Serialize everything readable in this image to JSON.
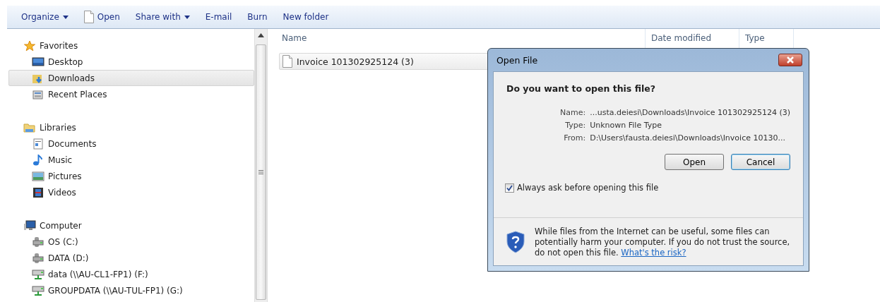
{
  "toolbar": [
    {
      "label": "Organize",
      "kind": "menu"
    },
    {
      "label": "Open",
      "kind": "file"
    },
    {
      "label": "Share with",
      "kind": "menu"
    },
    {
      "label": "E-mail",
      "kind": "plain"
    },
    {
      "label": "Burn",
      "kind": "plain"
    },
    {
      "label": "New folder",
      "kind": "plain"
    }
  ],
  "sidebar": {
    "groups": [
      {
        "label": "Favorites",
        "kind": "favorites",
        "selected": false,
        "children": [
          {
            "label": "Desktop",
            "kind": "desktop",
            "selected": false
          },
          {
            "label": "Downloads",
            "kind": "downloads",
            "selected": true
          },
          {
            "label": "Recent Places",
            "kind": "recent",
            "selected": false
          }
        ]
      },
      {
        "label": "Libraries",
        "kind": "libraries",
        "selected": false,
        "children": [
          {
            "label": "Documents",
            "kind": "documents",
            "selected": false
          },
          {
            "label": "Music",
            "kind": "music",
            "selected": false
          },
          {
            "label": "Pictures",
            "kind": "pictures",
            "selected": false
          },
          {
            "label": "Videos",
            "kind": "videos",
            "selected": false
          }
        ]
      },
      {
        "label": "Computer",
        "kind": "computer",
        "selected": false,
        "children": [
          {
            "label": "OS (C:)",
            "kind": "drive",
            "selected": false
          },
          {
            "label": "DATA (D:)",
            "kind": "drive",
            "selected": false
          },
          {
            "label": "data (\\\\AU-CL1-FP1) (F:)",
            "kind": "network",
            "selected": false
          },
          {
            "label": "GROUPDATA (\\\\AU-TUL-FP1) (G:)",
            "kind": "network",
            "selected": false
          }
        ]
      }
    ]
  },
  "file_list": {
    "columns": [
      "Name",
      "Date modified",
      "Type"
    ],
    "rows": [
      {
        "name": "Invoice 101302925124 (3)",
        "selected": true
      }
    ]
  },
  "dialog": {
    "title": "Open File",
    "heading": "Do you want to open this file?",
    "details": [
      {
        "label": "Name:",
        "value": "...usta.deiesi\\Downloads\\Invoice 101302925124 (3)"
      },
      {
        "label": "Type:",
        "value": "Unknown File Type"
      },
      {
        "label": "From:",
        "value": "D:\\Users\\fausta.deiesi\\Downloads\\Invoice 10130..."
      }
    ],
    "buttons": [
      {
        "label": "Open",
        "kind": "normal"
      },
      {
        "label": "Cancel",
        "kind": "default"
      }
    ],
    "checkbox": {
      "label": "Always ask before opening this file",
      "checked": true
    },
    "warning": "While files from the Internet can be useful, some files can potentially harm your computer. If you do not trust the source, do not open this file.",
    "link": "What's the risk?"
  }
}
